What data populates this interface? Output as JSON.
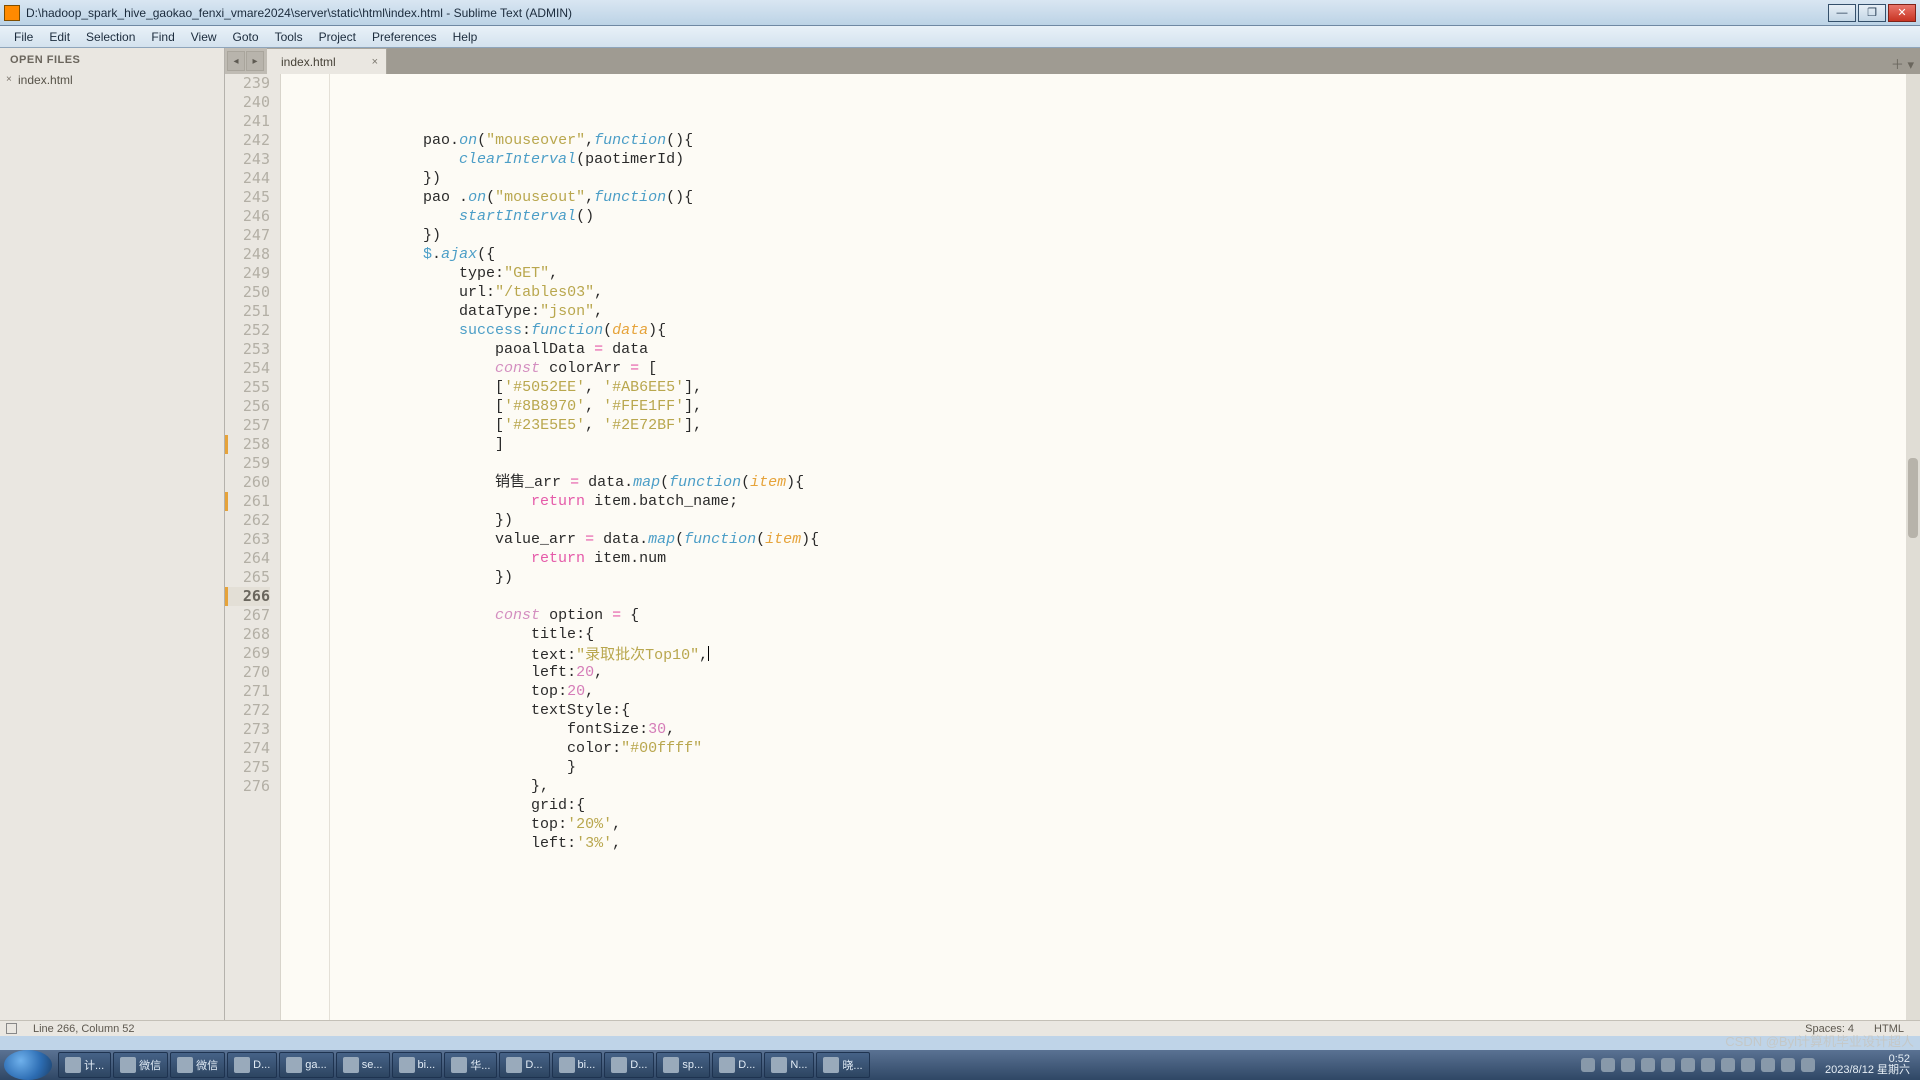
{
  "window": {
    "title": "D:\\hadoop_spark_hive_gaokao_fenxi_vmare2024\\server\\static\\html\\index.html - Sublime Text (ADMIN)"
  },
  "menu": [
    "File",
    "Edit",
    "Selection",
    "Find",
    "View",
    "Goto",
    "Tools",
    "Project",
    "Preferences",
    "Help"
  ],
  "sidebar": {
    "section": "OPEN FILES",
    "files": [
      {
        "name": "index.html"
      }
    ]
  },
  "tabs": {
    "active": "index.html"
  },
  "editor": {
    "first_line": 239,
    "selected_line": 266,
    "modified_lines": [
      258,
      261,
      266
    ],
    "lines": [
      {
        "n": 239,
        "segs": [
          [
            "i",
            "              "
          ],
          [
            "d",
            "pao"
          ],
          [
            "d",
            "."
          ],
          [
            "f",
            "on"
          ],
          [
            "d",
            "("
          ],
          [
            "s",
            "\"mouseover\""
          ],
          [
            "d",
            ","
          ],
          [
            "p",
            "function"
          ],
          [
            "d",
            "(){"
          ]
        ]
      },
      {
        "n": 240,
        "segs": [
          [
            "i",
            "                  "
          ],
          [
            "f",
            "clearInterval"
          ],
          [
            "d",
            "(paotimerId)"
          ]
        ]
      },
      {
        "n": 241,
        "segs": [
          [
            "i",
            "              "
          ],
          [
            "d",
            "})"
          ]
        ]
      },
      {
        "n": 242,
        "segs": [
          [
            "i",
            "              "
          ],
          [
            "d",
            "pao "
          ],
          [
            "d",
            "."
          ],
          [
            "f",
            "on"
          ],
          [
            "d",
            "("
          ],
          [
            "s",
            "\"mouseout\""
          ],
          [
            "d",
            ","
          ],
          [
            "p",
            "function"
          ],
          [
            "d",
            "(){"
          ]
        ]
      },
      {
        "n": 243,
        "segs": [
          [
            "i",
            "                  "
          ],
          [
            "f",
            "startInterval"
          ],
          [
            "d",
            "()"
          ]
        ]
      },
      {
        "n": 244,
        "segs": [
          [
            "i",
            "              "
          ],
          [
            "d",
            "})"
          ]
        ]
      },
      {
        "n": 245,
        "segs": [
          [
            "i",
            "              "
          ],
          [
            "t",
            "$"
          ],
          [
            "d",
            "."
          ],
          [
            "f",
            "ajax"
          ],
          [
            "d",
            "({"
          ]
        ]
      },
      {
        "n": 246,
        "segs": [
          [
            "i",
            "                  "
          ],
          [
            "d",
            "type"
          ],
          [
            "d",
            ":"
          ],
          [
            "s",
            "\"GET\""
          ],
          [
            "d",
            ","
          ]
        ]
      },
      {
        "n": 247,
        "segs": [
          [
            "i",
            "                  "
          ],
          [
            "d",
            "url"
          ],
          [
            "d",
            ":"
          ],
          [
            "s",
            "\"/tables03\""
          ],
          [
            "d",
            ","
          ]
        ]
      },
      {
        "n": 248,
        "segs": [
          [
            "i",
            "                  "
          ],
          [
            "d",
            "dataType"
          ],
          [
            "d",
            ":"
          ],
          [
            "s",
            "\"json\""
          ],
          [
            "d",
            ","
          ]
        ]
      },
      {
        "n": 249,
        "segs": [
          [
            "i",
            "                  "
          ],
          [
            "t",
            "success"
          ],
          [
            "d",
            ":"
          ],
          [
            "p",
            "function"
          ],
          [
            "d",
            "("
          ],
          [
            "pa",
            "data"
          ],
          [
            "d",
            "){"
          ]
        ]
      },
      {
        "n": 250,
        "segs": [
          [
            "i",
            "                      "
          ],
          [
            "d",
            "paoallData "
          ],
          [
            "k",
            "="
          ],
          [
            "d",
            " data"
          ]
        ]
      },
      {
        "n": 251,
        "segs": [
          [
            "i",
            "                      "
          ],
          [
            "c",
            "const"
          ],
          [
            "d",
            " colorArr "
          ],
          [
            "k",
            "="
          ],
          [
            "d",
            " ["
          ]
        ]
      },
      {
        "n": 252,
        "segs": [
          [
            "i",
            "                      "
          ],
          [
            "d",
            "["
          ],
          [
            "s",
            "'#5052EE'"
          ],
          [
            "d",
            ", "
          ],
          [
            "s",
            "'#AB6EE5'"
          ],
          [
            "d",
            "],"
          ]
        ]
      },
      {
        "n": 253,
        "segs": [
          [
            "i",
            "                      "
          ],
          [
            "d",
            "["
          ],
          [
            "s",
            "'#8B8970'"
          ],
          [
            "d",
            ", "
          ],
          [
            "s",
            "'#FFE1FF'"
          ],
          [
            "d",
            "],"
          ]
        ]
      },
      {
        "n": 254,
        "segs": [
          [
            "i",
            "                      "
          ],
          [
            "d",
            "["
          ],
          [
            "s",
            "'#23E5E5'"
          ],
          [
            "d",
            ", "
          ],
          [
            "s",
            "'#2E72BF'"
          ],
          [
            "d",
            "],"
          ]
        ]
      },
      {
        "n": 255,
        "segs": [
          [
            "i",
            "                      "
          ],
          [
            "d",
            "]"
          ]
        ]
      },
      {
        "n": 256,
        "segs": [
          [
            "i",
            ""
          ]
        ]
      },
      {
        "n": 257,
        "segs": [
          [
            "i",
            "                      "
          ],
          [
            "d",
            "销售_arr "
          ],
          [
            "k",
            "="
          ],
          [
            "d",
            " data."
          ],
          [
            "f",
            "map"
          ],
          [
            "d",
            "("
          ],
          [
            "p",
            "function"
          ],
          [
            "d",
            "("
          ],
          [
            "pa",
            "item"
          ],
          [
            "d",
            "){"
          ]
        ]
      },
      {
        "n": 258,
        "segs": [
          [
            "i",
            "                          "
          ],
          [
            "k",
            "return"
          ],
          [
            "d",
            " item.batch_name;"
          ]
        ]
      },
      {
        "n": 259,
        "segs": [
          [
            "i",
            "                      "
          ],
          [
            "d",
            "})"
          ]
        ]
      },
      {
        "n": 260,
        "segs": [
          [
            "i",
            "                      "
          ],
          [
            "d",
            "value_arr "
          ],
          [
            "k",
            "="
          ],
          [
            "d",
            " data."
          ],
          [
            "f",
            "map"
          ],
          [
            "d",
            "("
          ],
          [
            "p",
            "function"
          ],
          [
            "d",
            "("
          ],
          [
            "pa",
            "item"
          ],
          [
            "d",
            "){"
          ]
        ]
      },
      {
        "n": 261,
        "segs": [
          [
            "i",
            "                          "
          ],
          [
            "k",
            "return"
          ],
          [
            "d",
            " item.num"
          ]
        ]
      },
      {
        "n": 262,
        "segs": [
          [
            "i",
            "                      "
          ],
          [
            "d",
            "})"
          ]
        ]
      },
      {
        "n": 263,
        "segs": [
          [
            "i",
            ""
          ]
        ]
      },
      {
        "n": 264,
        "segs": [
          [
            "i",
            "                      "
          ],
          [
            "c",
            "const"
          ],
          [
            "d",
            " option "
          ],
          [
            "k",
            "="
          ],
          [
            "d",
            " {"
          ]
        ]
      },
      {
        "n": 265,
        "segs": [
          [
            "i",
            "                          "
          ],
          [
            "d",
            "title"
          ],
          [
            "d",
            ":{"
          ]
        ]
      },
      {
        "n": 266,
        "segs": [
          [
            "i",
            "                          "
          ],
          [
            "d",
            "text"
          ],
          [
            "d",
            ":"
          ],
          [
            "s",
            "\"录取批次Top10\""
          ],
          [
            "d",
            ","
          ]
        ]
      },
      {
        "n": 267,
        "segs": [
          [
            "i",
            "                          "
          ],
          [
            "d",
            "left"
          ],
          [
            "d",
            ":"
          ],
          [
            "n",
            "20"
          ],
          [
            "d",
            ","
          ]
        ]
      },
      {
        "n": 268,
        "segs": [
          [
            "i",
            "                          "
          ],
          [
            "d",
            "top"
          ],
          [
            "d",
            ":"
          ],
          [
            "n",
            "20"
          ],
          [
            "d",
            ","
          ]
        ]
      },
      {
        "n": 269,
        "segs": [
          [
            "i",
            "                          "
          ],
          [
            "d",
            "textStyle"
          ],
          [
            "d",
            ":{"
          ]
        ]
      },
      {
        "n": 270,
        "segs": [
          [
            "i",
            "                              "
          ],
          [
            "d",
            "fontSize"
          ],
          [
            "d",
            ":"
          ],
          [
            "n",
            "30"
          ],
          [
            "d",
            ","
          ]
        ]
      },
      {
        "n": 271,
        "segs": [
          [
            "i",
            "                              "
          ],
          [
            "d",
            "color"
          ],
          [
            "d",
            ":"
          ],
          [
            "s",
            "\"#00ffff\""
          ]
        ]
      },
      {
        "n": 272,
        "segs": [
          [
            "i",
            "                              "
          ],
          [
            "d",
            "}"
          ]
        ]
      },
      {
        "n": 273,
        "segs": [
          [
            "i",
            "                          "
          ],
          [
            "d",
            "},"
          ]
        ]
      },
      {
        "n": 274,
        "segs": [
          [
            "i",
            "                          "
          ],
          [
            "d",
            "grid"
          ],
          [
            "d",
            ":{"
          ]
        ]
      },
      {
        "n": 275,
        "segs": [
          [
            "i",
            "                          "
          ],
          [
            "d",
            "top"
          ],
          [
            "d",
            ":"
          ],
          [
            "s",
            "'20%'"
          ],
          [
            "d",
            ","
          ]
        ]
      },
      {
        "n": 276,
        "segs": [
          [
            "i",
            "                          "
          ],
          [
            "d",
            "left"
          ],
          [
            "d",
            ":"
          ],
          [
            "s",
            "'3%'"
          ],
          [
            "d",
            ","
          ]
        ]
      }
    ]
  },
  "status": {
    "pos": "Line 266, Column 52",
    "spaces": "Spaces: 4",
    "lang": "HTML"
  },
  "taskbar": {
    "buttons": [
      "计...",
      "微信",
      "微信",
      "D...",
      "ga...",
      "se...",
      "bi...",
      "华...",
      "D...",
      "bi...",
      "D...",
      "sp...",
      "D...",
      "N...",
      "晓..."
    ],
    "clock_time": "0:52",
    "clock_date": "2023/8/12 星期六"
  },
  "watermark": "CSDN @Byl计算机毕业设计超人"
}
